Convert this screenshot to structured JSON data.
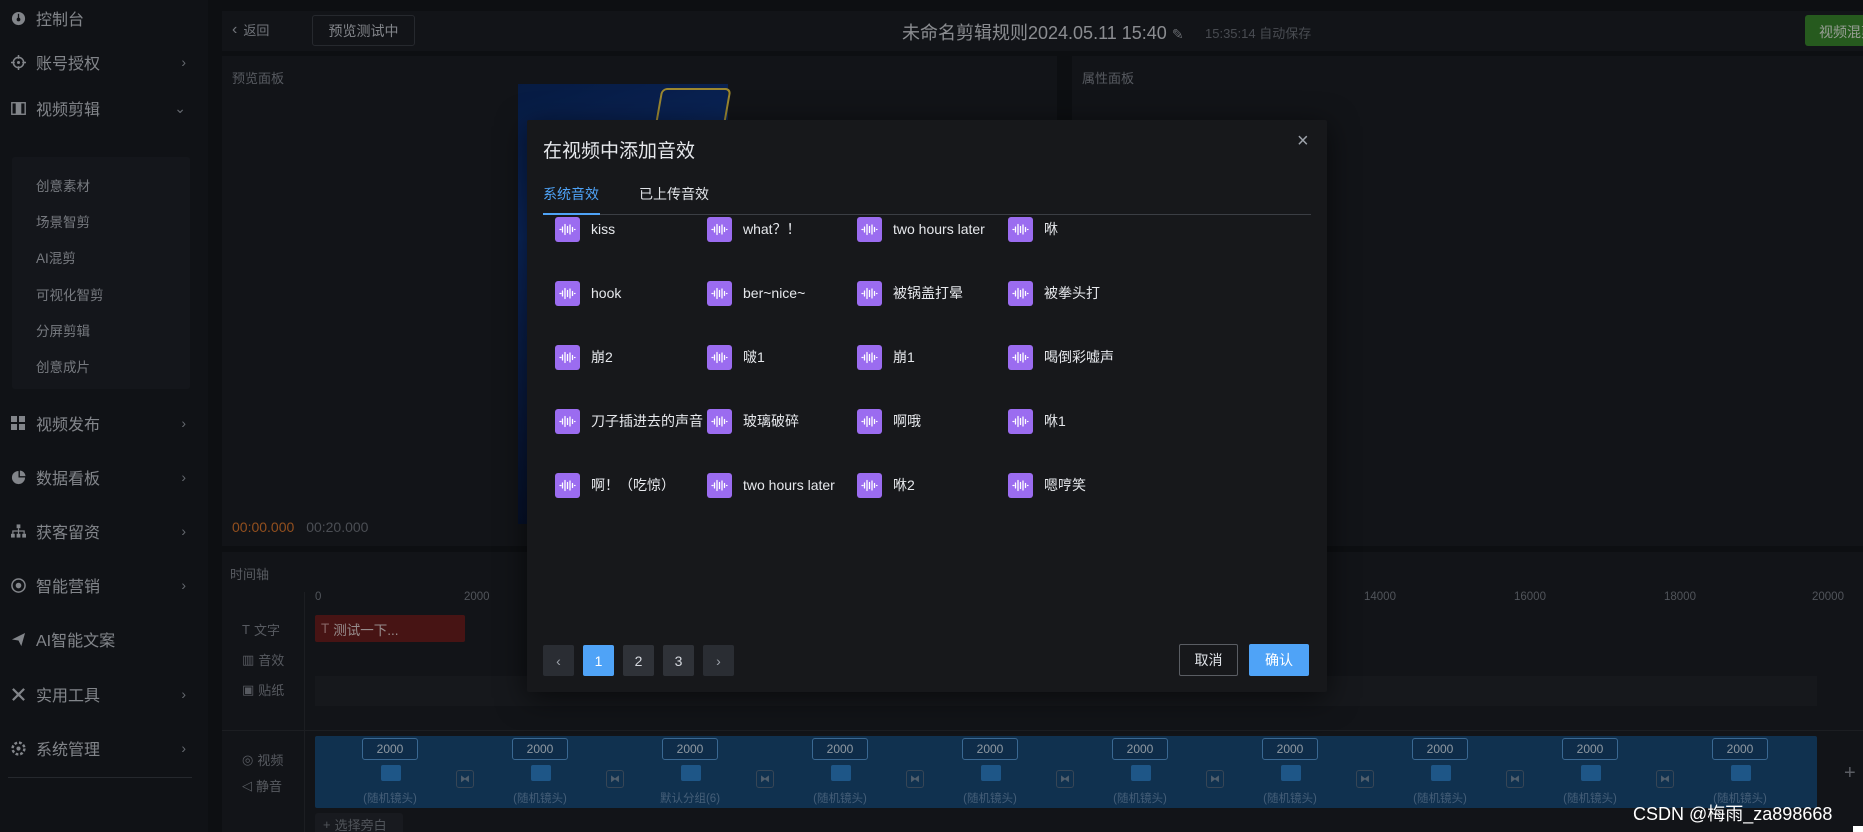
{
  "sidebar": {
    "items": [
      {
        "label": "控制台",
        "icon": "dashboard-icon",
        "has_chevron": false
      },
      {
        "label": "账号授权",
        "icon": "target-icon",
        "has_chevron": true
      },
      {
        "label": "视频剪辑",
        "icon": "film-icon",
        "has_chevron": true,
        "expanded": true
      },
      {
        "label": "视频发布",
        "icon": "grid-icon",
        "has_chevron": true
      },
      {
        "label": "数据看板",
        "icon": "pie-chart-icon",
        "has_chevron": true
      },
      {
        "label": "获客留资",
        "icon": "org-chart-icon",
        "has_chevron": true
      },
      {
        "label": "智能营销",
        "icon": "dashboard-gauge-icon",
        "has_chevron": true
      },
      {
        "label": "AI智能文案",
        "icon": "send-icon",
        "has_chevron": false
      },
      {
        "label": "实用工具",
        "icon": "tools-icon",
        "has_chevron": true
      },
      {
        "label": "系统管理",
        "icon": "gear-icon",
        "has_chevron": true
      }
    ],
    "submenu": [
      "创意素材",
      "场景智剪",
      "AI混剪",
      "可视化智剪",
      "分屏剪辑",
      "创意成片"
    ]
  },
  "header": {
    "back_label": "返回",
    "preview_test_label": "预览测试中",
    "title": "未命名剪辑规则2024.05.11 15:40",
    "autosave": "15:35:14 自动保存",
    "right_button": "视频混剪"
  },
  "preview": {
    "label": "预览面板",
    "current_time": "00:00.000",
    "total_time": "00:20.000"
  },
  "properties": {
    "label": "属性面板"
  },
  "timeline": {
    "label": "时间轴",
    "ruler": [
      "0",
      "2000",
      "14000",
      "16000",
      "18000",
      "20000"
    ],
    "tracks": [
      "文字",
      "音效",
      "贴纸",
      "视频",
      "静音"
    ],
    "text_clip": "测试一下...",
    "video_clips": [
      {
        "duration": "2000",
        "caption": "(随机镜头)"
      },
      {
        "duration": "2000",
        "caption": "(随机镜头)"
      },
      {
        "duration": "2000",
        "caption": "默认分组(6)"
      },
      {
        "duration": "2000",
        "caption": "(随机镜头)"
      },
      {
        "duration": "2000",
        "caption": "(随机镜头)"
      },
      {
        "duration": "2000",
        "caption": "(随机镜头)"
      },
      {
        "duration": "2000",
        "caption": "(随机镜头)"
      },
      {
        "duration": "2000",
        "caption": "(随机镜头)"
      },
      {
        "duration": "2000",
        "caption": "(随机镜头)"
      },
      {
        "duration": "2000",
        "caption": "(随机镜头)"
      }
    ],
    "add_voiceover": "选择旁白"
  },
  "modal": {
    "title": "在视频中添加音效",
    "tabs": [
      {
        "label": "系统音效",
        "active": true
      },
      {
        "label": "已上传音效",
        "active": false
      }
    ],
    "sounds": [
      "kiss",
      "what？！",
      "two hours later",
      "咻",
      "hook",
      "ber~nice~",
      "被锅盖打晕",
      "被拳头打",
      "崩2",
      "啵1",
      "崩1",
      "喝倒彩嘘声",
      "刀子插进去的声音",
      "玻璃破碎",
      "啊哦",
      "咻1",
      "啊！（吃惊）",
      "two hours later",
      "咻2",
      "嗯哼笑"
    ],
    "pagination": {
      "pages": [
        "1",
        "2",
        "3"
      ],
      "current": "1",
      "prev": "‹",
      "next": "›"
    },
    "cancel_label": "取消",
    "confirm_label": "确认",
    "close_icon": "close-icon"
  },
  "watermark": "CSDN @梅雨_za898668",
  "colors": {
    "accent_blue": "#4fa3f7",
    "sound_icon_purple": "#9b6cf0",
    "green_button": "#3b8a2e",
    "text_clip_red": "#6e1f1f",
    "video_track_blue": "#1a4c7a",
    "timecode_orange": "#e07a2f"
  }
}
